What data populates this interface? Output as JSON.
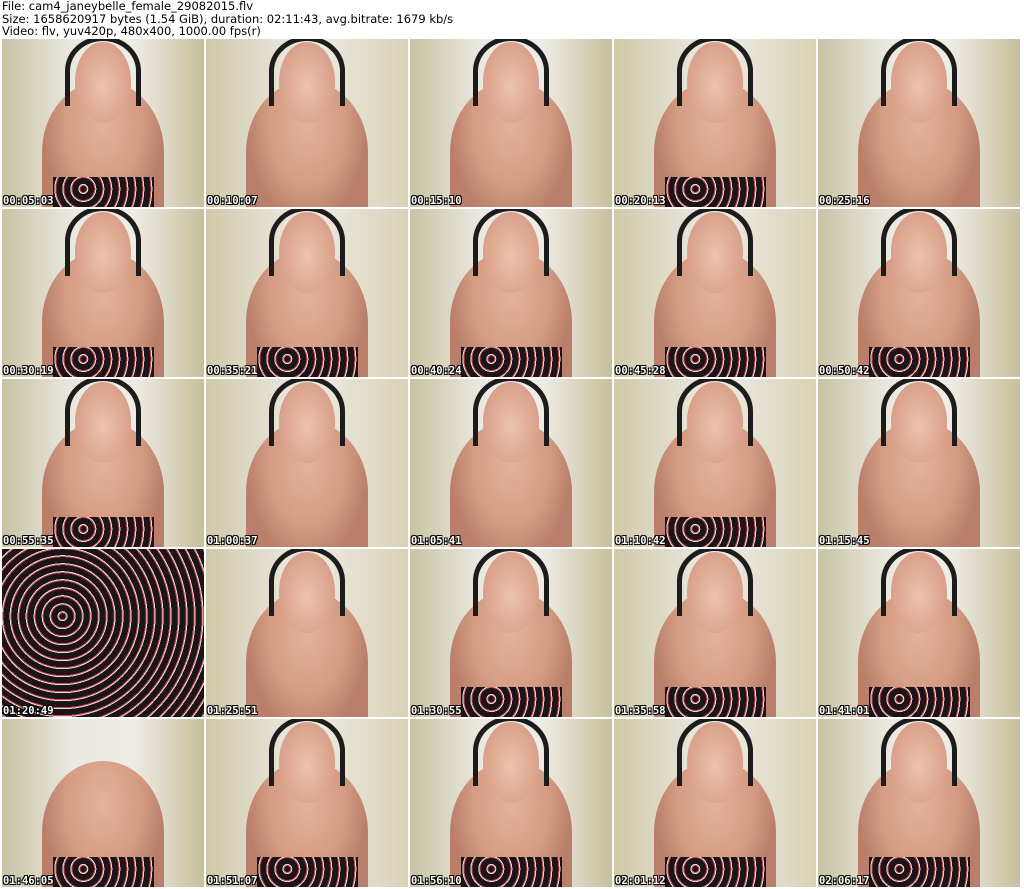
{
  "header": {
    "file_line": "File: cam4_janeybelle_female_29082015.flv",
    "size_line": "Size: 1658620917 bytes (1.54 GiB), duration: 02:11:43, avg.bitrate: 1679 kb/s",
    "video_line": "Video: flv, yuv420p, 480x400, 1000.00 fps(r)"
  },
  "thumbnails": [
    {
      "time": "00:05:03"
    },
    {
      "time": "00:10:07"
    },
    {
      "time": "00:15:10"
    },
    {
      "time": "00:20:13"
    },
    {
      "time": "00:25:16"
    },
    {
      "time": "00:30:19"
    },
    {
      "time": "00:35:21"
    },
    {
      "time": "00:40:24"
    },
    {
      "time": "00:45:28"
    },
    {
      "time": "00:50:42"
    },
    {
      "time": "00:55:35"
    },
    {
      "time": "01:00:37"
    },
    {
      "time": "01:05:41"
    },
    {
      "time": "01:10:42"
    },
    {
      "time": "01:15:45"
    },
    {
      "time": "01:20:49"
    },
    {
      "time": "01:25:51"
    },
    {
      "time": "01:30:55"
    },
    {
      "time": "01:35:58"
    },
    {
      "time": "01:41:01"
    },
    {
      "time": "01:46:05"
    },
    {
      "time": "01:51:07"
    },
    {
      "time": "01:56:10"
    },
    {
      "time": "02:01:12"
    },
    {
      "time": "02:06:17"
    }
  ]
}
